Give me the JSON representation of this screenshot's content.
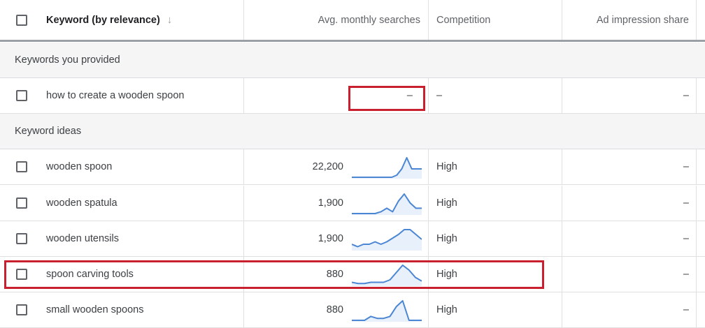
{
  "header": {
    "checkbox": "",
    "keyword": "Keyword (by relevance)",
    "sort_icon": "↓",
    "avg": "Avg. monthly searches",
    "competition": "Competition",
    "ad_share": "Ad impression share"
  },
  "groups": {
    "provided": "Keywords you provided",
    "ideas": "Keyword ideas"
  },
  "provided_rows": [
    {
      "keyword": "how to create a wooden spoon",
      "avg": "–",
      "competition": "–",
      "ad_share": "–"
    }
  ],
  "idea_rows": [
    {
      "keyword": "wooden spoon",
      "avg": "22,200",
      "competition": "High",
      "ad_share": "–",
      "trend": [
        0,
        0,
        0,
        0,
        0,
        0,
        0,
        0,
        0,
        3,
        12,
        28,
        12,
        12,
        12
      ]
    },
    {
      "keyword": "wooden spatula",
      "avg": "1,900",
      "competition": "High",
      "ad_share": "–",
      "trend": [
        0,
        0,
        0,
        0,
        0,
        2,
        6,
        2,
        14,
        22,
        12,
        6,
        6
      ]
    },
    {
      "keyword": "wooden utensils",
      "avg": "1,900",
      "competition": "High",
      "ad_share": "–",
      "trend": [
        4,
        2,
        4,
        4,
        6,
        4,
        6,
        9,
        12,
        16,
        16,
        12,
        8
      ]
    },
    {
      "keyword": "spoon carving tools",
      "avg": "880",
      "competition": "High",
      "ad_share": "–",
      "trend": [
        2,
        1,
        1,
        2,
        2,
        2,
        4,
        10,
        16,
        12,
        6,
        3
      ]
    },
    {
      "keyword": "small wooden spoons",
      "avg": "880",
      "competition": "High",
      "ad_share": "–",
      "trend": [
        0,
        0,
        0,
        4,
        2,
        2,
        4,
        14,
        20,
        0,
        0,
        0
      ]
    }
  ],
  "colors": {
    "sparkline": "#4a86d4",
    "sparkline_fill": "#e8f0fb",
    "callout": "#c8202e"
  }
}
